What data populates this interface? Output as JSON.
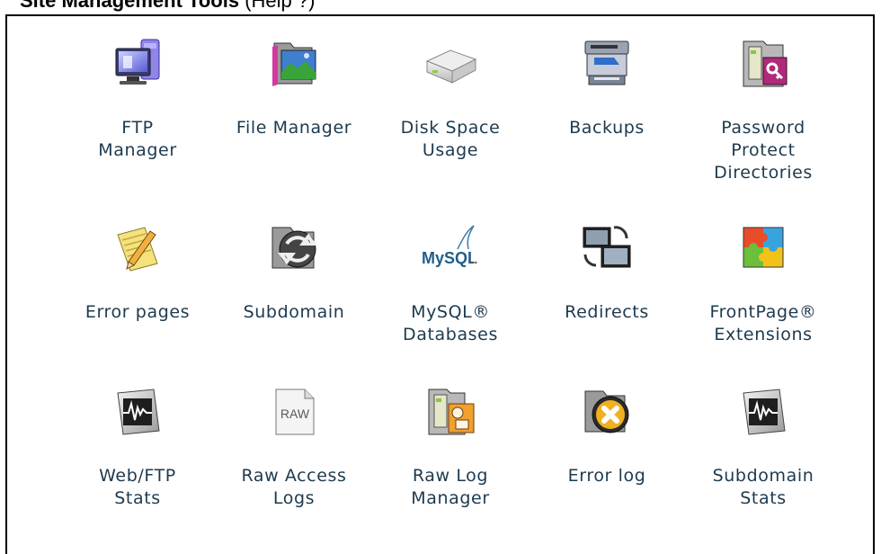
{
  "header": {
    "title": "Site Management Tools",
    "suffix": "(Help ?)"
  },
  "tools": [
    {
      "name": "ftp-manager",
      "icon": "monitor-icon",
      "lines": [
        "FTP",
        "Manager"
      ]
    },
    {
      "name": "file-manager",
      "icon": "folder-picture-icon",
      "lines": [
        "File Manager"
      ]
    },
    {
      "name": "disk-space-usage",
      "icon": "hard-drive-icon",
      "lines": [
        "Disk Space",
        "Usage"
      ]
    },
    {
      "name": "backups",
      "icon": "backup-drive-icon",
      "lines": [
        "Backups"
      ]
    },
    {
      "name": "password-protect-directories",
      "icon": "key-folder-icon",
      "lines": [
        "Password",
        "Protect",
        "Directories"
      ]
    },
    {
      "name": "error-pages",
      "icon": "notepad-pencil-icon",
      "lines": [
        "Error pages"
      ]
    },
    {
      "name": "subdomain",
      "icon": "subdomain-folder-icon",
      "lines": [
        "Subdomain"
      ]
    },
    {
      "name": "mysql-databases",
      "icon": "mysql-logo-icon",
      "lines": [
        "MySQL®",
        "Databases"
      ]
    },
    {
      "name": "redirects",
      "icon": "redirect-monitors-icon",
      "lines": [
        "Redirects"
      ]
    },
    {
      "name": "frontpage-extensions",
      "icon": "puzzle-icon",
      "lines": [
        "FrontPage®",
        "Extensions"
      ]
    },
    {
      "name": "web-ftp-stats",
      "icon": "stats-waveform-icon",
      "lines": [
        "Web/FTP",
        "Stats"
      ]
    },
    {
      "name": "raw-access-logs",
      "icon": "raw-document-icon",
      "lines": [
        "Raw Access",
        "Logs"
      ]
    },
    {
      "name": "raw-log-manager",
      "icon": "log-manager-icon",
      "lines": [
        "Raw Log",
        "Manager"
      ]
    },
    {
      "name": "error-log",
      "icon": "error-x-folder-icon",
      "lines": [
        "Error log"
      ]
    },
    {
      "name": "subdomain-stats",
      "icon": "stats-waveform-icon",
      "lines": [
        "Subdomain",
        "Stats"
      ]
    }
  ],
  "mysql_logo_text": "MySQL"
}
